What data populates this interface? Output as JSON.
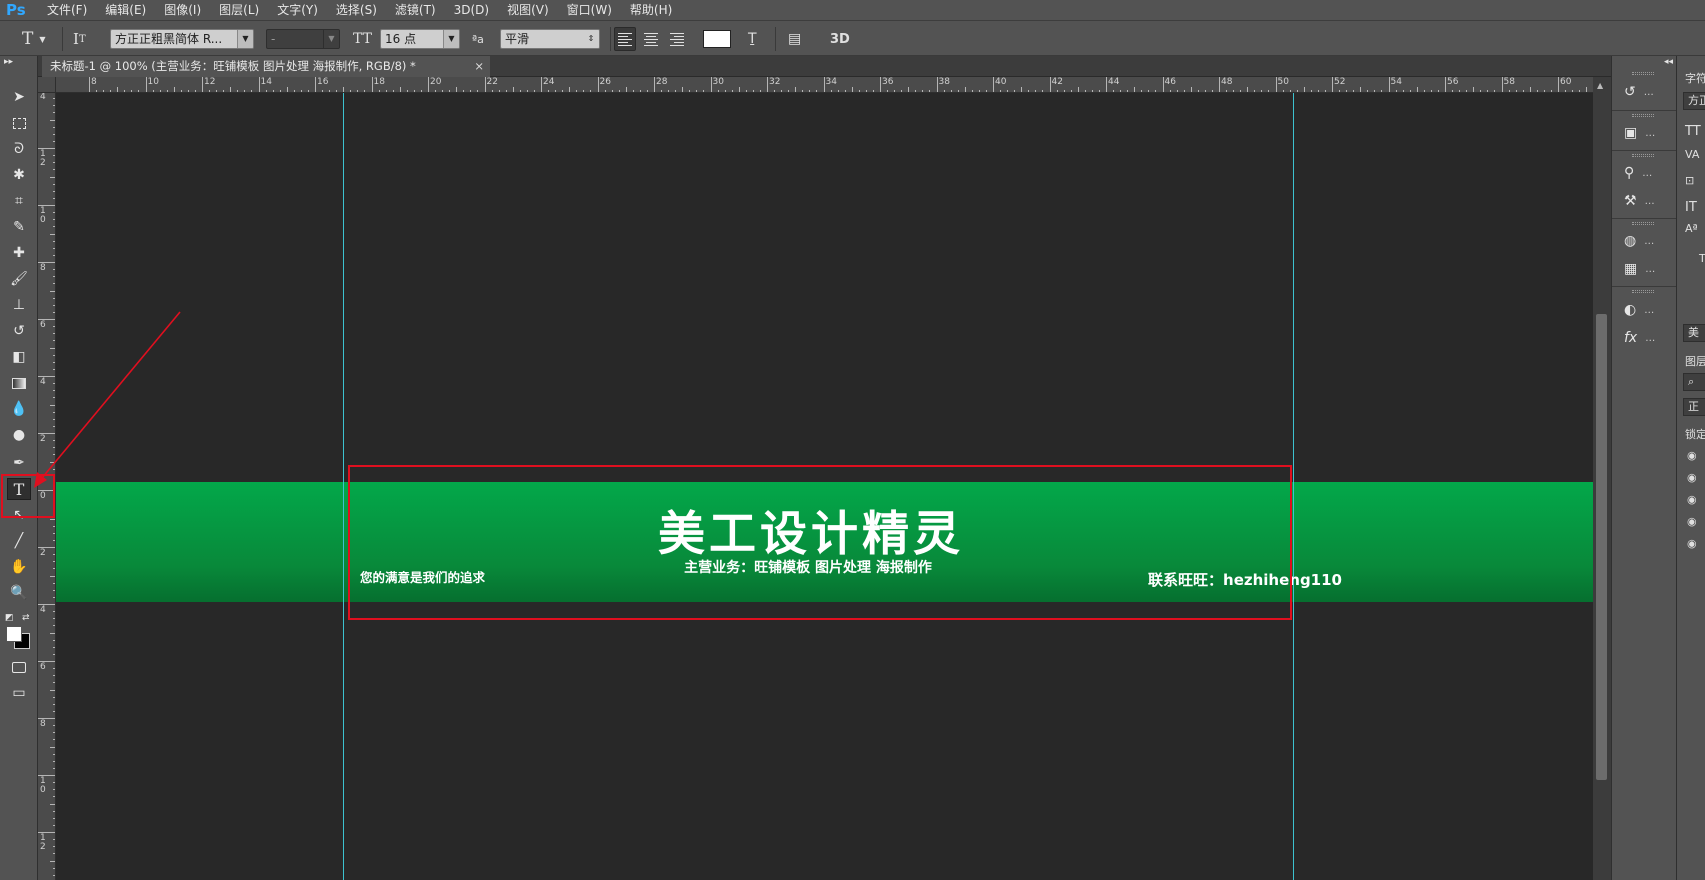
{
  "app": {
    "logo": "Ps"
  },
  "menu": [
    "文件(F)",
    "编辑(E)",
    "图像(I)",
    "图层(L)",
    "文字(Y)",
    "选择(S)",
    "滤镜(T)",
    "3D(D)",
    "视图(V)",
    "窗口(W)",
    "帮助(H)"
  ],
  "options": {
    "font_family": "方正正粗黑简体 R...",
    "font_style": "-",
    "font_size": "16 点",
    "antialias_prefix": "ªa",
    "antialias": "平滑",
    "text_color": "#ffffff",
    "threed_label": "3D"
  },
  "document": {
    "tab_title": "未标题-1 @ 100% (主营业务：旺铺模板 图片处理 海报制作, RGB/8) *",
    "close_glyph": "×"
  },
  "ruler": {
    "horizontal": [
      "8",
      "10",
      "12",
      "14",
      "16",
      "18",
      "20",
      "22",
      "24",
      "26",
      "28",
      "30",
      "32",
      "34",
      "36",
      "38",
      "40",
      "42",
      "44",
      "46",
      "48",
      "50",
      "52",
      "54",
      "56",
      "58",
      "60"
    ],
    "vertical": [
      "4",
      "1 2",
      "1 0",
      "8",
      "6",
      "4",
      "2",
      "0",
      "2",
      "4",
      "6",
      "8",
      "1 0",
      "1 2"
    ]
  },
  "canvas": {
    "banner_title": "美工设计精灵",
    "banner_subtitle": "主营业务：旺铺模板 图片处理 海报制作",
    "banner_left": "您的满意是我们的追求",
    "banner_right": "联系旺旺：hezhiheng110",
    "banner_color": "#049b43",
    "guide_color": "#3dc2cf",
    "annotation_color": "#e00f1f"
  },
  "right_panel": {
    "character_tab": "字符",
    "font_abbrev": "方正",
    "layer_name_abbrev": "美",
    "layers_tab": "图层",
    "blend_abbrev": "正",
    "lock_label": "锁定"
  }
}
